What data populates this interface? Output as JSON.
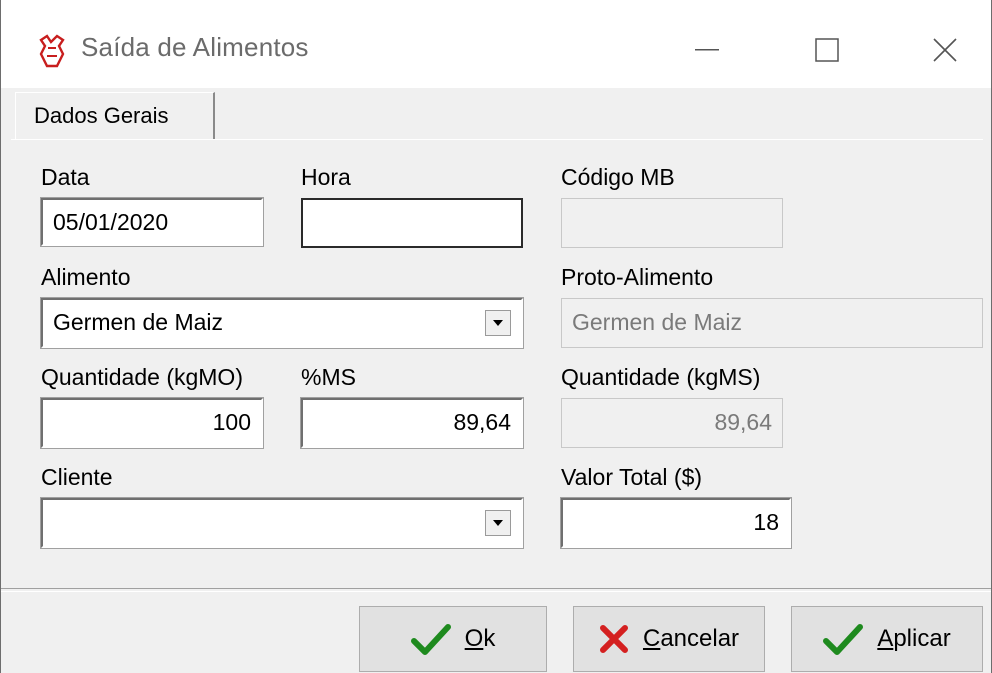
{
  "window": {
    "title": "Saída de Alimentos"
  },
  "tabs": [
    {
      "label": "Dados Gerais"
    }
  ],
  "form": {
    "data": {
      "label": "Data",
      "value": "05/01/2020"
    },
    "hora": {
      "label": "Hora",
      "value": ""
    },
    "codigo_mb": {
      "label": "Código MB",
      "value": ""
    },
    "alimento": {
      "label": "Alimento",
      "value": "Germen de Maiz"
    },
    "proto_alimento": {
      "label": "Proto-Alimento",
      "value": "Germen de Maiz"
    },
    "quantidade_kgmo": {
      "label": "Quantidade (kgMO)",
      "value": "100"
    },
    "ms_pct": {
      "label": "%MS",
      "value": "89,64"
    },
    "quantidade_kgms": {
      "label": "Quantidade (kgMS)",
      "value": "89,64"
    },
    "cliente": {
      "label": "Cliente",
      "value": ""
    },
    "valor_total": {
      "label": "Valor Total ($)",
      "value": "18"
    }
  },
  "buttons": {
    "ok": {
      "mnemonic": "O",
      "rest": "k",
      "icon": "checkmark-icon"
    },
    "cancelar": {
      "mnemonic": "C",
      "rest": "ancelar",
      "icon": "x-icon"
    },
    "aplicar": {
      "mnemonic": "A",
      "rest": "plicar",
      "icon": "checkmark-icon"
    }
  },
  "colors": {
    "check_green": "#1e8a1e",
    "cancel_red": "#d42020",
    "icon_red": "#c81e1e"
  }
}
